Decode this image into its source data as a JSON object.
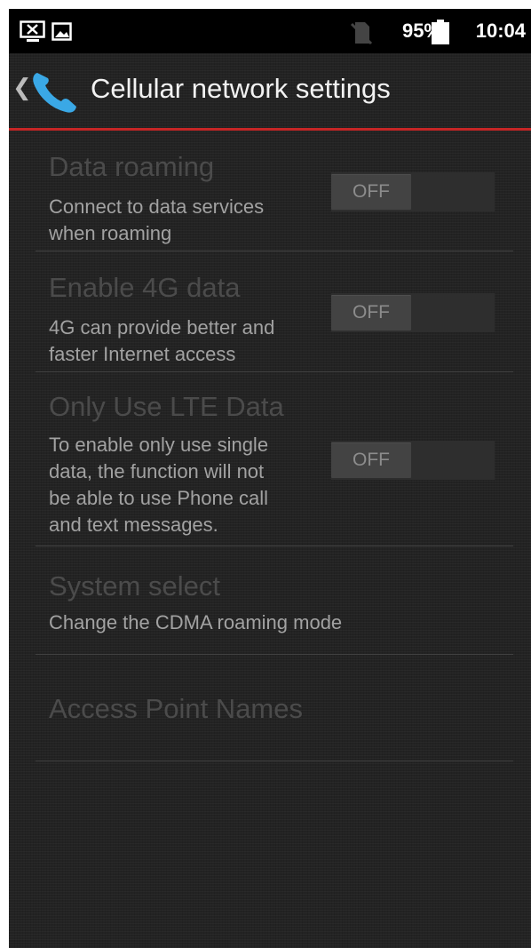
{
  "status_bar": {
    "icons": [
      "screenshot-icon",
      "gallery-icon",
      "no-sim-icon",
      "battery-icon"
    ],
    "battery_percent": "95%",
    "time": "10:04"
  },
  "action_bar": {
    "title": "Cellular network settings",
    "back_icon": "chevron-left-icon",
    "app_icon": "phone-icon",
    "accent_color": "#c62626"
  },
  "settings": {
    "data_roaming": {
      "title": "Data roaming",
      "summary_lines": [
        "Connect to data services",
        "when roaming"
      ],
      "toggle": "OFF"
    },
    "enable_4g": {
      "title": "Enable 4G data",
      "summary_lines": [
        "4G can provide better and",
        "faster Internet access"
      ],
      "toggle": "OFF"
    },
    "only_lte": {
      "title": "Only Use LTE Data",
      "summary_lines": [
        "To enable only use single",
        "data, the function will not",
        "be able to use Phone call",
        "and text messages."
      ],
      "toggle": "OFF"
    },
    "system_select": {
      "title": "System select",
      "summary": "Change the CDMA roaming mode"
    },
    "apn": {
      "title": "Access Point Names"
    }
  }
}
